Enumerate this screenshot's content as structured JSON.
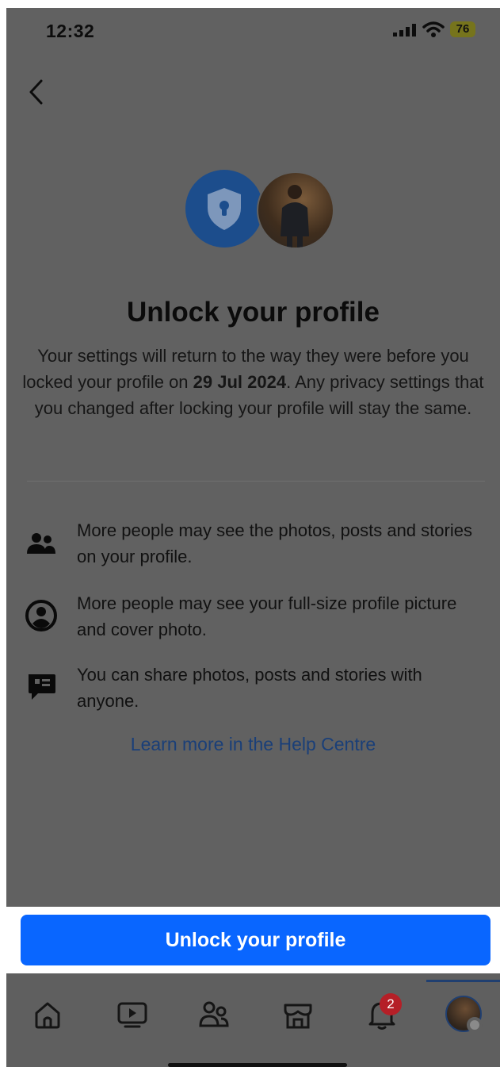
{
  "status_bar": {
    "time": "12:32",
    "battery": "76"
  },
  "page": {
    "title": "Unlock your profile",
    "description_before": "Your settings will return to the way they were before you locked your profile on ",
    "description_date": "29 Jul 2024",
    "description_after": ". Any privacy settings that you changed after locking your profile will stay the same."
  },
  "info_items": [
    {
      "icon": "people-icon",
      "text": "More people may see the photos, posts and stories on your profile."
    },
    {
      "icon": "profile-picture-icon",
      "text": "More people may see your full-size profile picture and cover photo."
    },
    {
      "icon": "share-icon",
      "text": "You can share photos, posts and stories with anyone."
    }
  ],
  "help_link": "Learn more in the Help Centre",
  "cta_button": "Unlock your profile",
  "tab_bar": {
    "tabs": [
      "home-icon",
      "video-icon",
      "friends-icon",
      "marketplace-icon",
      "notifications-icon",
      "profile-avatar-icon"
    ],
    "notification_count": "2",
    "active_tab": "profile",
    "colors": {
      "cta": "#0966ff",
      "badge": "#b51f27"
    }
  }
}
